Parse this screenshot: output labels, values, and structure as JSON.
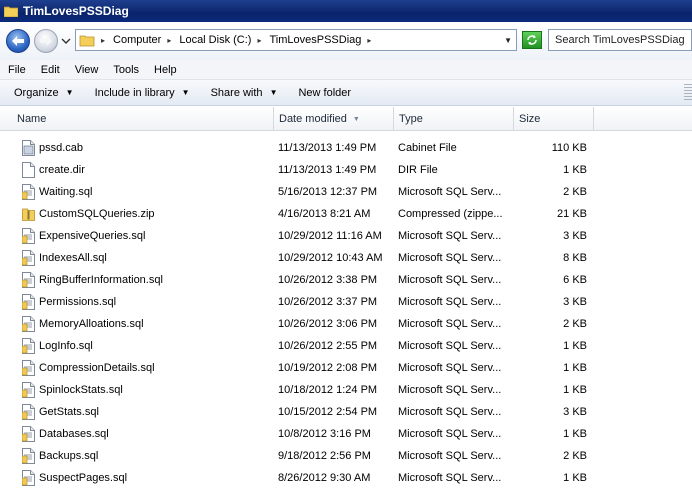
{
  "window": {
    "title": "TimLovesPSSDiag"
  },
  "address": {
    "crumbs": [
      "Computer",
      "Local Disk (C:)",
      "TimLovesPSSDiag"
    ]
  },
  "search": {
    "placeholder": "Search TimLovesPSSDiag"
  },
  "menu": [
    "File",
    "Edit",
    "View",
    "Tools",
    "Help"
  ],
  "commands": [
    {
      "label": "Organize",
      "has_arrow": true
    },
    {
      "label": "Include in library",
      "has_arrow": true
    },
    {
      "label": "Share with",
      "has_arrow": true
    },
    {
      "label": "New folder",
      "has_arrow": false
    }
  ],
  "columns": {
    "name": "Name",
    "date": "Date modified",
    "type": "Type",
    "size": "Size"
  },
  "files": [
    {
      "name": "pssd.cab",
      "date": "11/13/2013 1:49 PM",
      "type": "Cabinet File",
      "size": "110 KB",
      "icon": "cab-file-icon"
    },
    {
      "name": "create.dir",
      "date": "11/13/2013 1:49 PM",
      "type": "DIR File",
      "size": "1 KB",
      "icon": "blank-file-icon"
    },
    {
      "name": "Waiting.sql",
      "date": "5/16/2013 12:37 PM",
      "type": "Microsoft SQL Serv...",
      "size": "2 KB",
      "icon": "sql-file-icon"
    },
    {
      "name": "CustomSQLQueries.zip",
      "date": "4/16/2013 8:21 AM",
      "type": "Compressed (zippe...",
      "size": "21 KB",
      "icon": "zip-folder-icon"
    },
    {
      "name": "ExpensiveQueries.sql",
      "date": "10/29/2012 11:16 AM",
      "type": "Microsoft SQL Serv...",
      "size": "3 KB",
      "icon": "sql-file-icon"
    },
    {
      "name": "IndexesAll.sql",
      "date": "10/29/2012 10:43 AM",
      "type": "Microsoft SQL Serv...",
      "size": "8 KB",
      "icon": "sql-file-icon"
    },
    {
      "name": "RingBufferInformation.sql",
      "date": "10/26/2012 3:38 PM",
      "type": "Microsoft SQL Serv...",
      "size": "6 KB",
      "icon": "sql-file-icon"
    },
    {
      "name": "Permissions.sql",
      "date": "10/26/2012 3:37 PM",
      "type": "Microsoft SQL Serv...",
      "size": "3 KB",
      "icon": "sql-file-icon"
    },
    {
      "name": "MemoryAlloations.sql",
      "date": "10/26/2012 3:06 PM",
      "type": "Microsoft SQL Serv...",
      "size": "2 KB",
      "icon": "sql-file-icon"
    },
    {
      "name": "LogInfo.sql",
      "date": "10/26/2012 2:55 PM",
      "type": "Microsoft SQL Serv...",
      "size": "1 KB",
      "icon": "sql-file-icon"
    },
    {
      "name": "CompressionDetails.sql",
      "date": "10/19/2012 2:08 PM",
      "type": "Microsoft SQL Serv...",
      "size": "1 KB",
      "icon": "sql-file-icon"
    },
    {
      "name": "SpinlockStats.sql",
      "date": "10/18/2012 1:24 PM",
      "type": "Microsoft SQL Serv...",
      "size": "1 KB",
      "icon": "sql-file-icon"
    },
    {
      "name": "GetStats.sql",
      "date": "10/15/2012 2:54 PM",
      "type": "Microsoft SQL Serv...",
      "size": "3 KB",
      "icon": "sql-file-icon"
    },
    {
      "name": "Databases.sql",
      "date": "10/8/2012 3:16 PM",
      "type": "Microsoft SQL Serv...",
      "size": "1 KB",
      "icon": "sql-file-icon"
    },
    {
      "name": "Backups.sql",
      "date": "9/18/2012 2:56 PM",
      "type": "Microsoft SQL Serv...",
      "size": "2 KB",
      "icon": "sql-file-icon"
    },
    {
      "name": "SuspectPages.sql",
      "date": "8/26/2012 9:30 AM",
      "type": "Microsoft SQL Serv...",
      "size": "1 KB",
      "icon": "sql-file-icon"
    }
  ],
  "colors": {
    "titlebar": "#0a246a",
    "accent": "#2d66c4"
  }
}
